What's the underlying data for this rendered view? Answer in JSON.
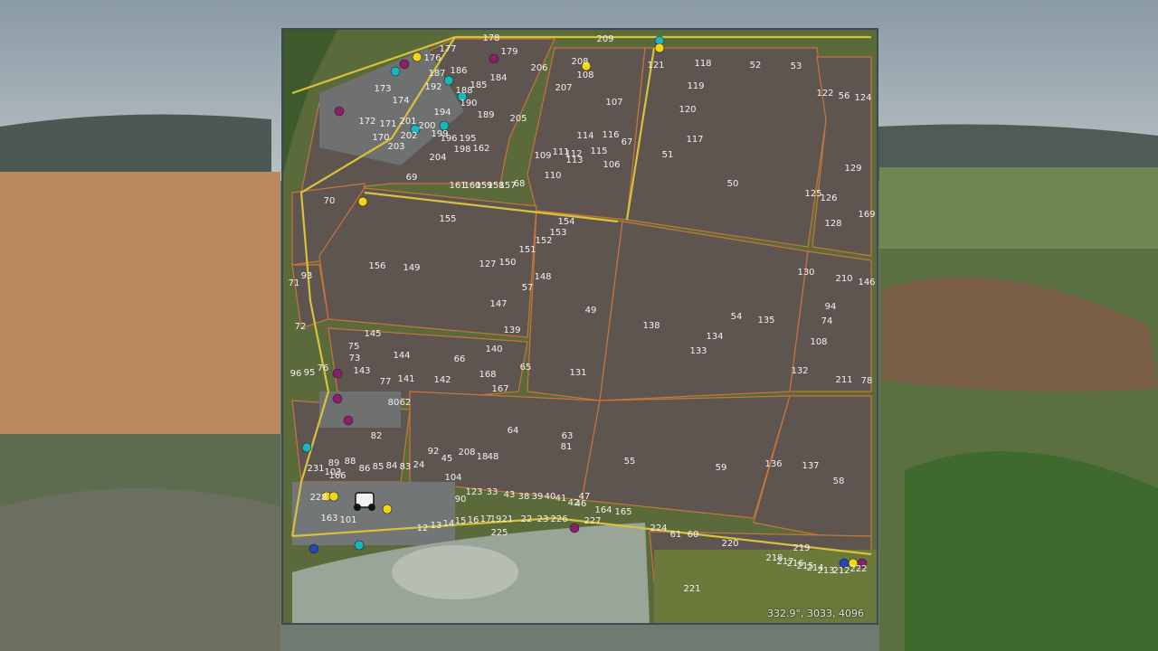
{
  "map": {
    "coordinates": "332.9°, 3033, 4096",
    "field_labels": [
      "178",
      "209",
      "177",
      "179",
      "176",
      "206",
      "208",
      "108",
      "121",
      "118",
      "52",
      "53",
      "187",
      "186",
      "192",
      "188",
      "185",
      "184",
      "173",
      "174",
      "207",
      "107",
      "119",
      "122",
      "56",
      "124",
      "190",
      "194",
      "189",
      "205",
      "120",
      "172",
      "171",
      "201",
      "202",
      "200",
      "199",
      "196",
      "195",
      "198",
      "162",
      "170",
      "203",
      "204",
      "109",
      "111",
      "112",
      "113",
      "114",
      "116",
      "67",
      "115",
      "106",
      "117",
      "51",
      "129",
      "69",
      "161",
      "160",
      "159",
      "158",
      "157",
      "68",
      "110",
      "50",
      "125",
      "126",
      "70",
      "155",
      "154",
      "153",
      "152",
      "151",
      "150",
      "127",
      "128",
      "169",
      "93",
      "71",
      "156",
      "149",
      "148",
      "57",
      "130",
      "210",
      "146",
      "147",
      "49",
      "138",
      "54",
      "135",
      "94",
      "72",
      "145",
      "139",
      "134",
      "74",
      "75",
      "73",
      "144",
      "140",
      "133",
      "108",
      "96",
      "95",
      "76",
      "143",
      "66",
      "65",
      "131",
      "132",
      "211",
      "78",
      "77",
      "141",
      "142",
      "168",
      "167",
      "80",
      "62",
      "64",
      "63",
      "81",
      "82",
      "92",
      "45",
      "208",
      "18",
      "48",
      "55",
      "59",
      "136",
      "137",
      "58",
      "231",
      "89",
      "88",
      "86",
      "85",
      "84",
      "83",
      "24",
      "104",
      "103",
      "166",
      "228",
      "90",
      "123",
      "33",
      "43",
      "38",
      "39",
      "40",
      "41",
      "42",
      "46",
      "47",
      "164",
      "165",
      "163",
      "101",
      "12",
      "13",
      "14",
      "15",
      "16",
      "17",
      "19",
      "21",
      "22",
      "23",
      "226",
      "227",
      "225",
      "224",
      "61",
      "60",
      "220",
      "219",
      "218",
      "217",
      "216",
      "215",
      "214",
      "213",
      "212",
      "222",
      "221"
    ]
  },
  "colors": {
    "field_fill": "#5e5550",
    "boundary": "#c8743d",
    "road": "#d8c23c",
    "water": "#9aa59a",
    "marker_yellow": "#f1d516",
    "marker_cyan": "#18b7bf",
    "marker_magenta": "#8c1f6b",
    "marker_blue": "#2346b8"
  },
  "icons": [
    "player-vehicle-icon"
  ]
}
